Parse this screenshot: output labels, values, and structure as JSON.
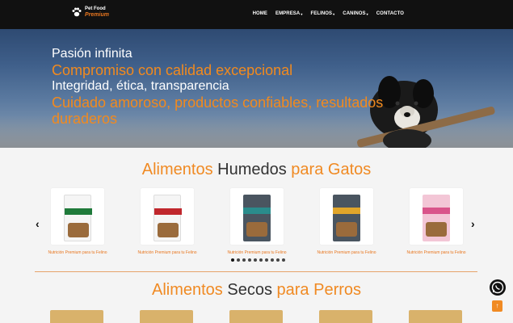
{
  "header": {
    "logo_top": "Pet Food",
    "logo_bottom": "Premium",
    "nav": [
      {
        "label": "HOME",
        "has_dropdown": false
      },
      {
        "label": "EMPRESA",
        "has_dropdown": true
      },
      {
        "label": "FELINOS",
        "has_dropdown": true
      },
      {
        "label": "CANINOS",
        "has_dropdown": true
      },
      {
        "label": "CONTACTO",
        "has_dropdown": false
      }
    ]
  },
  "hero": {
    "line1": "Pasión infinita",
    "line2": "Compromiso con calidad excepcional",
    "line3": "Integridad, ética, transparencia",
    "line4": "Cuidado amoroso, productos confiables, resultados",
    "line5": "duraderos"
  },
  "section1": {
    "title_a": "Alimentos",
    "title_b": "Humedos",
    "title_c": "para Gatos"
  },
  "section2": {
    "title_a": "Alimentos",
    "title_b": "Secos",
    "title_c": "para Perros"
  },
  "products": [
    {
      "caption": "Nutrición Premium para tu Felino",
      "color": "#f5f5f5",
      "band": "#1f7a3a"
    },
    {
      "caption": "Nutrición Premium para tu Felino",
      "color": "#f5f5f5",
      "band": "#c0272d"
    },
    {
      "caption": "Nutrición Premium para tu Felino",
      "color": "#4a5560",
      "band": "#2a8c8c"
    },
    {
      "caption": "Nutrición Premium para tu Felino",
      "color": "#4a5560",
      "band": "#e0a52a"
    },
    {
      "caption": "Nutrición Premium para tu Felino",
      "color": "#f3c6d6",
      "band": "#d9548a"
    }
  ],
  "carousel": {
    "prev_icon": "chevron-left-icon",
    "next_icon": "chevron-right-icon",
    "dot_count": 10,
    "active_dot": 0
  },
  "floating": {
    "whatsapp_icon": "whatsapp-icon",
    "scroll_top_icon": "arrow-up-icon"
  },
  "colors": {
    "accent": "#f08a23",
    "header_bg": "#111111"
  }
}
